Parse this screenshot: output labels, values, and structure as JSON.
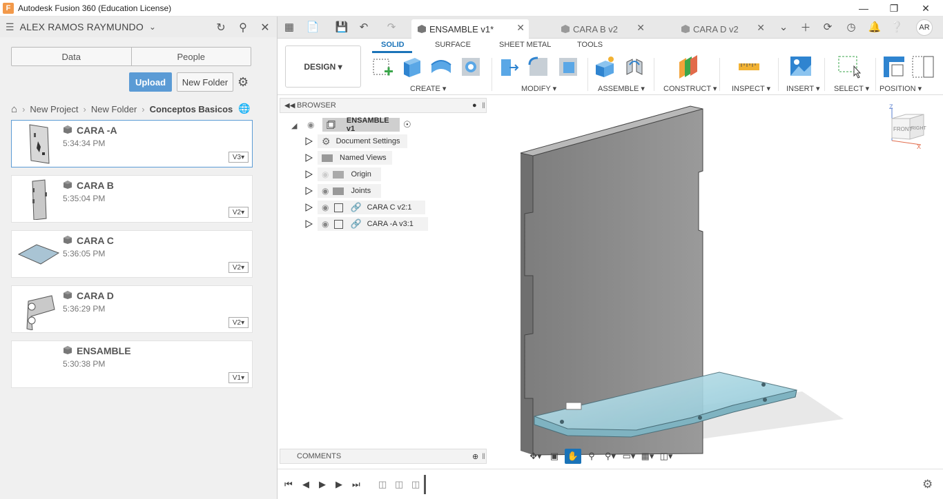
{
  "window": {
    "title": "Autodesk Fusion 360 (Education License)",
    "app_icon_letter": "F"
  },
  "data_panel": {
    "user_name": "ALEX RAMOS RAYMUNDO",
    "tabs": [
      "Data",
      "People"
    ],
    "upload_label": "Upload",
    "new_folder_label": "New Folder",
    "breadcrumb": [
      "New Project",
      "New Folder",
      "Conceptos Basicos"
    ],
    "files": [
      {
        "name": "CARA -A",
        "time": "5:34:34 PM",
        "version": "V3"
      },
      {
        "name": "CARA B",
        "time": "5:35:04 PM",
        "version": "V2"
      },
      {
        "name": "CARA C",
        "time": "5:36:05 PM",
        "version": "V2"
      },
      {
        "name": "CARA D",
        "time": "5:36:29 PM",
        "version": "V2"
      },
      {
        "name": "ENSAMBLE",
        "time": "5:30:38 PM",
        "version": "V1"
      }
    ]
  },
  "document_tabs": [
    {
      "label": "ENSAMBLE v1*",
      "active": true
    },
    {
      "label": "CARA B v2",
      "active": false
    },
    {
      "label": "CARA D v2",
      "active": false
    }
  ],
  "user_initials": "AR",
  "toolbar": {
    "workspace": "DESIGN",
    "ribbon_tabs": [
      "SOLID",
      "SURFACE",
      "SHEET METAL",
      "TOOLS"
    ],
    "groups": [
      "CREATE",
      "MODIFY",
      "ASSEMBLE",
      "CONSTRUCT",
      "INSPECT",
      "INSERT",
      "SELECT",
      "POSITION"
    ]
  },
  "browser": {
    "header": "BROWSER",
    "root": "ENSAMBLE v1",
    "items": [
      "Document Settings",
      "Named Views",
      "Origin",
      "Joints",
      "CARA C v2:1",
      "CARA -A v3:1"
    ]
  },
  "comments_label": "COMMENTS",
  "viewcube": {
    "top": "Z",
    "front": "FRONT",
    "right": "RIGHT",
    "x": "X"
  },
  "colors": {
    "accent": "#1a73b8",
    "upload": "#5b9bd5",
    "wall": "#8e8e8e",
    "glass": "#a9d3de"
  }
}
